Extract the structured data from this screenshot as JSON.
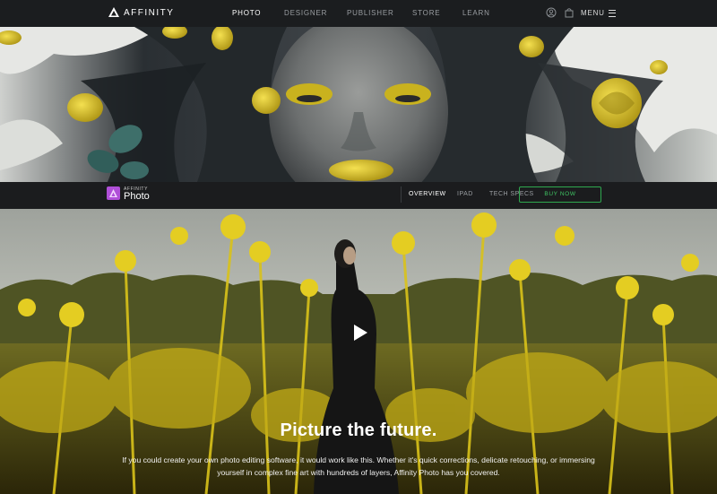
{
  "topnav": {
    "logo_text": "AFFINITY",
    "links": [
      "PHOTO",
      "DESIGNER",
      "PUBLISHER",
      "STORE",
      "LEARN"
    ],
    "active_link": "PHOTO",
    "menu_label": "MENU",
    "icons": [
      "user-account-icon",
      "shopping-bag-icon",
      "hamburger-menu-icon"
    ]
  },
  "subnav": {
    "product_brand": "AFFINITY",
    "product_name": "Photo",
    "links": [
      "OVERVIEW",
      "IPAD",
      "TECH SPECS"
    ],
    "active_link": "OVERVIEW",
    "buy_label": "BUY NOW"
  },
  "hero": {
    "headline": "Picture the future.",
    "body": "If you could create your own photo editing software, it would work like this. Whether it's quick corrections, delicate retouching, or immersing yourself in complex fine art with hundreds of layers, Affinity Photo has you covered."
  },
  "colors": {
    "nav_bg": "#1b1d1f",
    "buy_accent": "#3fc463",
    "photo_accent": "#b04fd8",
    "yellow_foliage": "#d9c21a"
  }
}
